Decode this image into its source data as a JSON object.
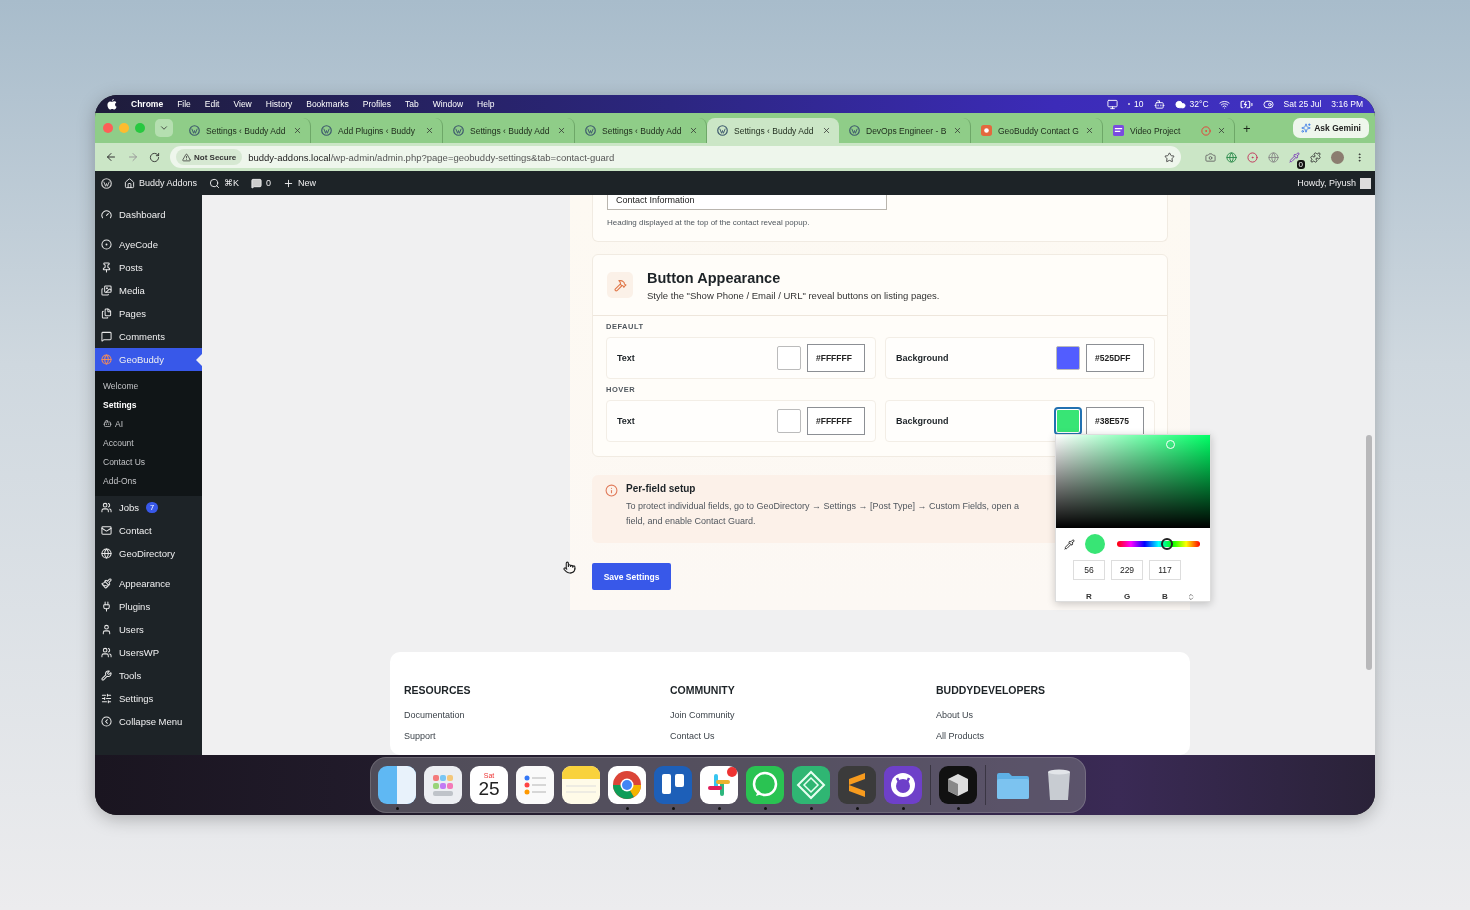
{
  "menubar": {
    "app": "Chrome",
    "menus": [
      "File",
      "Edit",
      "View",
      "History",
      "Bookmarks",
      "Profiles",
      "Tab",
      "Window",
      "Help"
    ],
    "box_count": "10",
    "temperature": "32°C",
    "date": "Sat 25 Jul",
    "time": "3:16 PM"
  },
  "browser": {
    "tabs": [
      {
        "title": "Settings ‹ Buddy Add",
        "kind": "wordpress",
        "selected": false,
        "recording": false
      },
      {
        "title": "Add Plugins ‹ Buddy",
        "kind": "wordpress",
        "selected": false,
        "recording": false
      },
      {
        "title": "Settings ‹ Buddy Add",
        "kind": "wordpress",
        "selected": false,
        "recording": false
      },
      {
        "title": "Settings ‹ Buddy Add",
        "kind": "wordpress",
        "selected": false,
        "recording": false
      },
      {
        "title": "Settings ‹ Buddy Add",
        "kind": "wordpress",
        "selected": true,
        "recording": false
      },
      {
        "title": "DevOps Engineer - B",
        "kind": "wordpress",
        "selected": false,
        "recording": false
      },
      {
        "title": "GeoBuddy Contact G",
        "kind": "geobuddy",
        "selected": false,
        "recording": false
      },
      {
        "title": "Video Project",
        "kind": "video",
        "selected": false,
        "recording": true
      }
    ],
    "new_tab": "+",
    "gemini": "Ask Gemini",
    "security": "Not Secure",
    "host": "buddy-addons.local",
    "path": "/wp-admin/admin.php?page=geobuddy-settings&tab=contact-guard",
    "extension_badge": "0"
  },
  "adminbar": {
    "site": "Buddy Addons",
    "search": "⌘K",
    "comments": "0",
    "new": "New",
    "greeting": "Howdy, Piyush"
  },
  "sidebar": {
    "groups": [
      [
        {
          "label": "Dashboard",
          "kind": "dashboard",
          "selected": false
        }
      ],
      [
        {
          "label": "AyeCode",
          "kind": "ayecode",
          "selected": false
        },
        {
          "label": "Posts",
          "kind": "posts",
          "selected": false
        },
        {
          "label": "Media",
          "kind": "media",
          "selected": false
        },
        {
          "label": "Pages",
          "kind": "pages",
          "selected": false
        },
        {
          "label": "Comments",
          "kind": "comments",
          "selected": false
        },
        {
          "label": "GeoBuddy",
          "kind": "geobuddy",
          "selected": true,
          "children": [
            {
              "label": "Welcome",
              "kind": "text",
              "selected": false
            },
            {
              "label": "Settings",
              "kind": "text",
              "selected": true
            },
            {
              "label": "AI",
              "kind": "bot",
              "selected": false
            },
            {
              "label": "Account",
              "kind": "text",
              "selected": false
            },
            {
              "label": "Contact Us",
              "kind": "text",
              "selected": false
            },
            {
              "label": "Add-Ons",
              "kind": "text",
              "selected": false
            }
          ]
        },
        {
          "label": "Jobs",
          "kind": "jobs",
          "selected": false,
          "badge": "7"
        },
        {
          "label": "Contact",
          "kind": "contact",
          "selected": false
        },
        {
          "label": "GeoDirectory",
          "kind": "geodirectory",
          "selected": false
        }
      ],
      [
        {
          "label": "Appearance",
          "kind": "appearance",
          "selected": false
        },
        {
          "label": "Plugins",
          "kind": "plugins",
          "selected": false
        },
        {
          "label": "Users",
          "kind": "users",
          "selected": false
        },
        {
          "label": "UsersWP",
          "kind": "userswp",
          "selected": false
        },
        {
          "label": "Tools",
          "kind": "tools",
          "selected": false
        },
        {
          "label": "Settings",
          "kind": "settings",
          "selected": false
        },
        {
          "label": "Collapse Menu",
          "kind": "collapse",
          "selected": false
        }
      ]
    ]
  },
  "content": {
    "heading_field": {
      "value": "Contact Information",
      "help": "Heading displayed at the top of the contact reveal popup."
    },
    "section": {
      "title": "Button Appearance",
      "subtitle": "Style the \"Show Phone / Email / URL\" reveal buttons on listing pages.",
      "groups": [
        {
          "label": "DEFAULT",
          "fields": [
            {
              "label": "Text",
              "color": "#ffffff",
              "value": "#FFFFFF",
              "active": false
            },
            {
              "label": "Background",
              "color": "#525dff",
              "value": "#525DFF",
              "active": false
            }
          ]
        },
        {
          "label": "HOVER",
          "fields": [
            {
              "label": "Text",
              "color": "#ffffff",
              "value": "#FFFFFF",
              "active": false
            },
            {
              "label": "Background",
              "color": "#38e575",
              "value": "#38E575",
              "active": true
            }
          ]
        }
      ]
    },
    "notice": {
      "title": "Per-field setup",
      "text": "To protect individual fields, go to GeoDirectory → Settings → [Post Type] → Custom Fields, open a field, and enable Contact Guard."
    },
    "save_button": "Save Settings",
    "color_picker": {
      "color": "#38e575",
      "hue": {
        "level": 0.6
      },
      "channels": [
        {
          "value": "56",
          "label": "R"
        },
        {
          "value": "229",
          "label": "G"
        },
        {
          "value": "117",
          "label": "B"
        }
      ]
    }
  },
  "footer": {
    "columns": [
      {
        "heading": "RESOURCES",
        "links": [
          "Documentation",
          "Support"
        ]
      },
      {
        "heading": "COMMUNITY",
        "links": [
          "Join Community",
          "Contact Us"
        ]
      },
      {
        "heading": "BUDDYDEVELOPERS",
        "links": [
          "About Us",
          "All Products"
        ]
      }
    ]
  },
  "dock": {
    "calendar_day": "Sat",
    "calendar_date": "25",
    "apps": [
      {
        "kind": "finder",
        "running": true
      },
      {
        "kind": "launchpad",
        "running": false
      },
      {
        "kind": "calendar",
        "running": false
      },
      {
        "kind": "reminders",
        "running": false
      },
      {
        "kind": "notes",
        "running": false
      },
      {
        "kind": "chrome",
        "running": true
      },
      {
        "kind": "trello",
        "running": true
      },
      {
        "kind": "slack",
        "running": true
      },
      {
        "kind": "whatsapp",
        "running": true
      },
      {
        "kind": "diamond",
        "running": true
      },
      {
        "kind": "sublime",
        "running": true
      },
      {
        "kind": "github",
        "running": true
      },
      {
        "kind": "cube",
        "running": true
      },
      {
        "kind": "folder",
        "running": false
      },
      {
        "kind": "trash",
        "running": false
      }
    ]
  }
}
